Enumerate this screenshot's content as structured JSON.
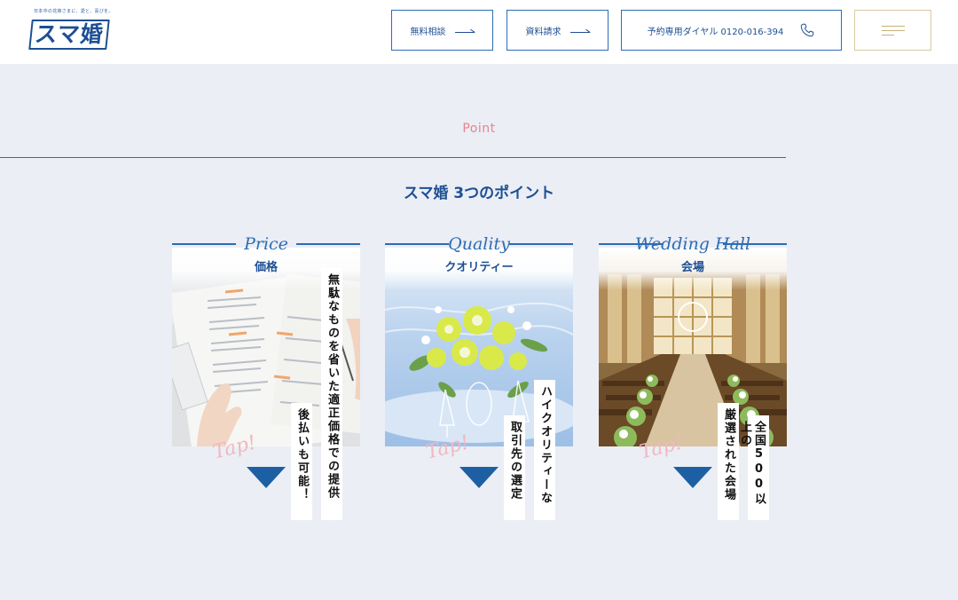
{
  "header": {
    "logo_tagline": "日本中の花嫁さまに、愛と、喜びを。",
    "logo_text": "スマ婚",
    "consult_label": "無料相談",
    "docs_label": "資料請求",
    "phone_label": "予約専用ダイヤル 0120-016-394",
    "icons": {
      "arrow": "right-arrow-icon",
      "phone": "phone-icon",
      "menu": "hamburger-menu-icon"
    }
  },
  "section": {
    "label": "Point",
    "title": "スマ婚 3つのポイント"
  },
  "cards": [
    {
      "script": "Price",
      "title": "価格",
      "text_right": "無駄なものを省いた適正価格での提供",
      "text_left": "後払いも可能！",
      "tap": "Tap!"
    },
    {
      "script": "Quality",
      "title": "クオリティー",
      "text_right": "ハイクオリティーな",
      "text_left": "取引先の選定",
      "tap": "Tap!"
    },
    {
      "script": "Wedding Hall",
      "title": "会場",
      "text_right": "全国500以上の",
      "text_left": "厳選された会場",
      "tap": "Tap!"
    }
  ],
  "colors": {
    "background": "#ebeef5",
    "brand_blue": "#1d4f93",
    "accent_blue": "#2d6cb3",
    "point_pink": "#e8838f",
    "menu_gold": "#c9b07c",
    "tap_pink": "#f1b8bf"
  }
}
